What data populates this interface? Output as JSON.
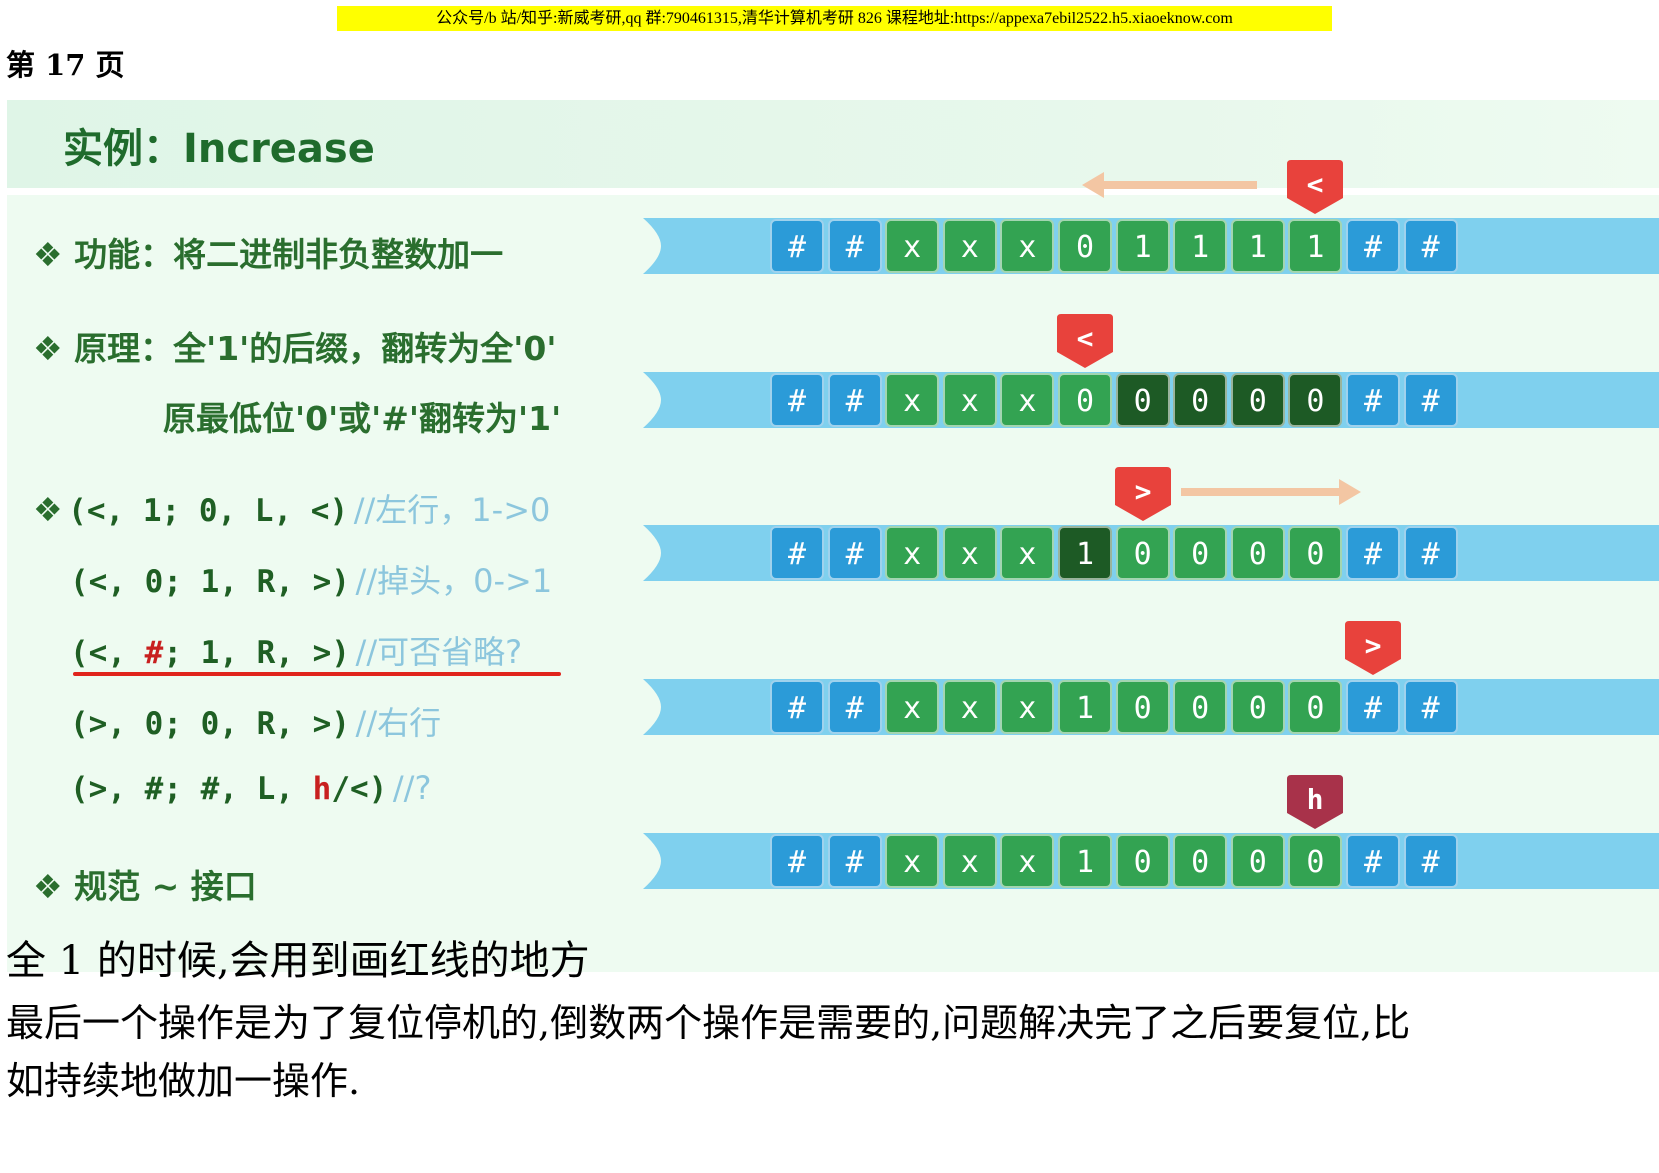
{
  "banner": "公众号/b 站/知乎:新威考研,qq 群:790461315,清华计算机考研 826 课程地址:https://appexa7ebil2522.h5.xiaoeknow.com",
  "page_label": "第 17 页",
  "slide": {
    "title": "实例：Increase",
    "func_line": "功能：将二进制非负整数加一",
    "principle_line1": "原理：全'1'的后缀，翻转为全'0'",
    "principle_line2": "原最低位'0'或'#'翻转为'1'",
    "bullet_symbol": "❖",
    "rules": [
      {
        "code": "(<, 1; 0, L, <)",
        "comment": "//左行，1->0"
      },
      {
        "code": "(<, 0; 1, R, >)",
        "comment": "//掉头，0->1"
      },
      {
        "code_pre": "(<, ",
        "code_red": "#",
        "code_post": "; 1, R, >)",
        "comment": "//可否省略?"
      },
      {
        "code": "(>, 0; 0, R, >)",
        "comment": "//右行"
      },
      {
        "code_pre": "(>, #; #, L, ",
        "code_red": "h",
        "code_post": "/<)",
        "comment": "//?"
      }
    ],
    "spec_line": "规范 ~ 接口",
    "tapes": [
      {
        "cells": [
          "#",
          "#",
          "x",
          "x",
          "x",
          "0",
          "1",
          "1",
          "1",
          "1",
          "#",
          "#"
        ],
        "dark": [],
        "head": "<",
        "head_index": 9,
        "arrow": "left"
      },
      {
        "cells": [
          "#",
          "#",
          "x",
          "x",
          "x",
          "0",
          "0",
          "0",
          "0",
          "0",
          "#",
          "#"
        ],
        "dark": [
          6,
          7,
          8,
          9
        ],
        "head": "<",
        "head_index": 5,
        "arrow": "none"
      },
      {
        "cells": [
          "#",
          "#",
          "x",
          "x",
          "x",
          "1",
          "0",
          "0",
          "0",
          "0",
          "#",
          "#"
        ],
        "dark": [
          5
        ],
        "head": ">",
        "head_index": 6,
        "arrow": "right"
      },
      {
        "cells": [
          "#",
          "#",
          "x",
          "x",
          "x",
          "1",
          "0",
          "0",
          "0",
          "0",
          "#",
          "#"
        ],
        "dark": [],
        "head": ">",
        "head_index": 10,
        "arrow": "none"
      },
      {
        "cells": [
          "#",
          "#",
          "x",
          "x",
          "x",
          "1",
          "0",
          "0",
          "0",
          "0",
          "#",
          "#"
        ],
        "dark": [],
        "head": "h",
        "head_index": 9,
        "arrow": "none"
      }
    ]
  },
  "notes": {
    "line1": "全 1 的时候,会用到画红线的地方",
    "line2": "最后一个操作是为了复位停机的,倒数两个操作是需要的,问题解决完了之后要复位,比",
    "line3": "如持续地做加一操作."
  },
  "colors": {
    "tape": "#7fd0ee",
    "cell_blue": "#2b9bd8",
    "cell_green": "#33a352",
    "cell_dark": "#1d5a25",
    "head_red": "#e8423c",
    "head_halt": "#a8324a",
    "arrow": "#f3c6a3"
  }
}
